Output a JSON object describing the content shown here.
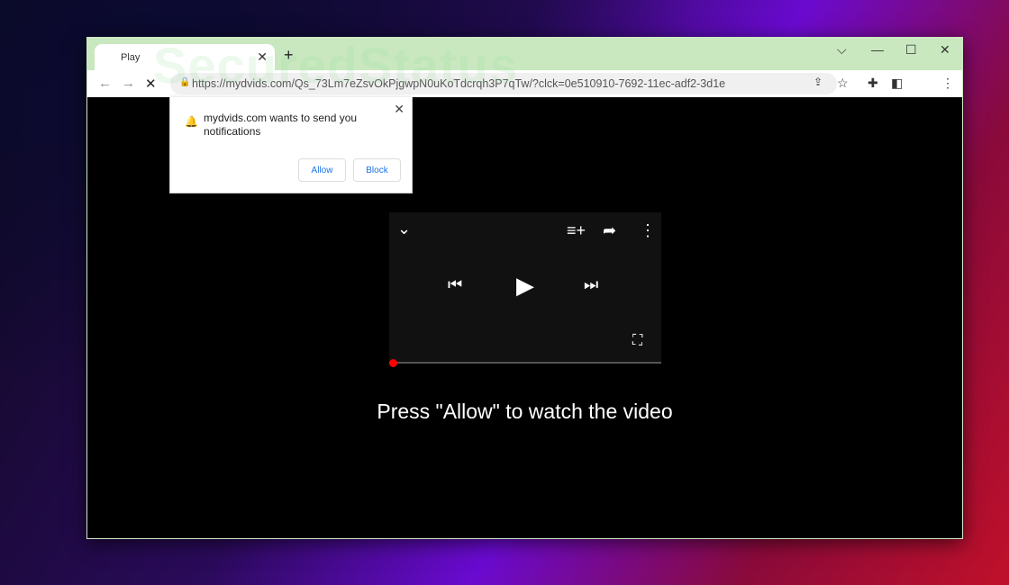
{
  "watermark": "SecuredStatus",
  "browser": {
    "tab_title": "Play",
    "url": "https://mydvids.com/Qs_73Lm7eZsvOkPjgwpN0uKoTdcrqh3P7qTw/?clck=0e510910-7692-11ec-adf2-3d1e"
  },
  "notification": {
    "message": "mydvids.com wants to send you notifications",
    "allow": "Allow",
    "block": "Block"
  },
  "player": {
    "progress_percent": 0,
    "accent": "#ff0000"
  },
  "page": {
    "prompt": "Press \"Allow\" to watch the video"
  }
}
